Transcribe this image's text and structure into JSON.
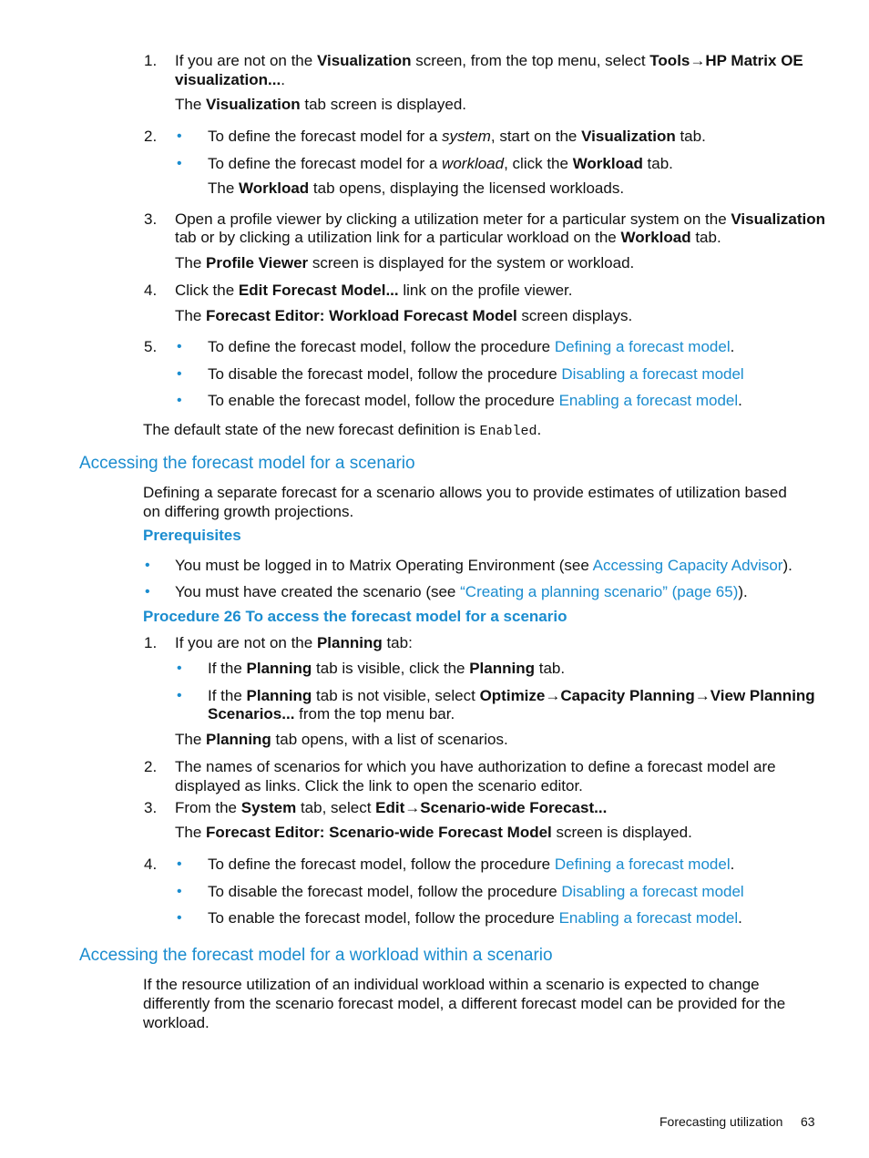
{
  "s1": {
    "n1": "1.",
    "l1a": "If you are not on the ",
    "l1b": "Visualization",
    "l1c": " screen, from the top menu, select ",
    "l1d": "Tools",
    "l1e": "→",
    "l1f": "HP Matrix OE",
    "l1g": "visualization...",
    "l1h": ".",
    "l1i": "The ",
    "l1j": "Visualization",
    "l1k": " tab screen is displayed.",
    "n2": "2.",
    "l2a": "To define the forecast model for a ",
    "l2b": "system",
    "l2c": ", start on the ",
    "l2d": "Visualization",
    "l2e": " tab.",
    "l2f": "To define the forecast model for a ",
    "l2g": "workload",
    "l2h": ", click the ",
    "l2i": "Workload",
    "l2j": " tab.",
    "l2k": "The ",
    "l2l": "Workload",
    "l2m": " tab opens, displaying the licensed workloads.",
    "n3": "3.",
    "l3a": "Open a profile viewer by clicking a utilization meter for a particular system on the ",
    "l3b": "Visualization",
    "l3c": "tab or by clicking a utilization link for a particular workload on the ",
    "l3d": "Workload",
    "l3e": " tab.",
    "l3f": "The ",
    "l3g": "Profile Viewer",
    "l3h": " screen is displayed for the system or workload.",
    "n4": "4.",
    "l4a": "Click the ",
    "l4b": "Edit Forecast Model...",
    "l4c": " link on the profile viewer.",
    "l4d": "The ",
    "l4e": "Forecast Editor: Workload Forecast Model",
    "l4f": " screen displays.",
    "n5": "5.",
    "l5a": "To define the forecast model, follow the procedure ",
    "l5b": "Defining a forecast model",
    "l5c": ".",
    "l5d": "To disable the forecast model, follow the procedure ",
    "l5e": "Disabling a forecast model",
    "l5f": "To enable the forecast model, follow the procedure ",
    "l5g": "Enabling a forecast model",
    "l5h": ".",
    "def_a": "The default state of the new forecast definition is ",
    "def_b": "Enabled",
    "def_c": "."
  },
  "sec2": {
    "heading": "Accessing the forecast model for a scenario",
    "p1": "Defining a separate forecast for a scenario allows you to provide estimates of utilization based",
    "p2": "on differing growth projections.",
    "prereq": "Prerequisites",
    "pr1a": "You must be logged in to Matrix Operating Environment (see ",
    "pr1b": "Accessing Capacity Advisor",
    "pr1c": ").",
    "pr2a": "You must have created the scenario (see ",
    "pr2b": "“Creating a planning scenario” (page 65)",
    "pr2c": ").",
    "proc": "Procedure 26 To access the forecast model for a scenario",
    "n1": "1.",
    "a1a": "If you are not on the ",
    "a1b": "Planning",
    "a1c": " tab:",
    "b1a": "If the ",
    "b1b": "Planning",
    "b1c": " tab is visible, click the ",
    "b1d": "Planning",
    "b1e": " tab.",
    "b2a": "If the ",
    "b2b": "Planning",
    "b2c": " tab is not visible, select ",
    "b2d": "Optimize",
    "b2e": "→",
    "b2f": "Capacity Planning",
    "b2g": "→",
    "b2h": "View Planning",
    "b2i": "Scenarios...",
    "b2j": " from the top menu bar.",
    "a1d": "The ",
    "a1e": "Planning",
    "a1f": " tab opens, with a list of scenarios.",
    "n2": "2.",
    "a2a": "The names of scenarios for which you have authorization to define a forecast model are",
    "a2b": "displayed as links. Click the link to open the scenario editor.",
    "n3": "3.",
    "a3a": "From the ",
    "a3b": "System",
    "a3c": " tab, select ",
    "a3d": "Edit",
    "a3e": "→",
    "a3f": "Scenario-wide Forecast...",
    "a3g": "The ",
    "a3h": "Forecast Editor: Scenario-wide Forecast Model",
    "a3i": " screen is displayed.",
    "n4": "4.",
    "a4a": "To define the forecast model, follow the procedure ",
    "a4b": "Defining a forecast model",
    "a4c": ".",
    "a4d": "To disable the forecast model, follow the procedure ",
    "a4e": "Disabling a forecast model",
    "a4f": "To enable the forecast model, follow the procedure ",
    "a4g": "Enabling a forecast model",
    "a4h": "."
  },
  "sec3": {
    "heading": "Accessing the forecast model for a workload within a scenario",
    "p1": "If the resource utilization of an individual workload within a scenario is expected to change",
    "p2": "differently from the scenario forecast model, a different forecast model can be provided for the",
    "p3": "workload."
  },
  "footer": {
    "section": "Forecasting utilization",
    "page": "63"
  },
  "bullet": "•"
}
